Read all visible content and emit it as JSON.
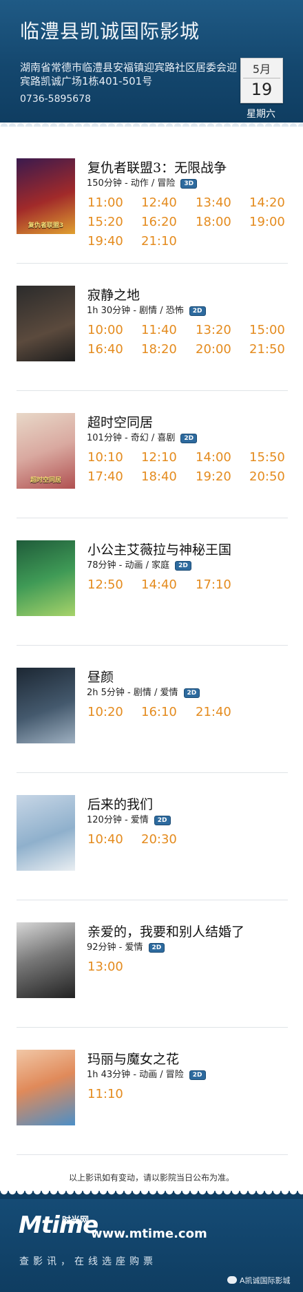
{
  "header": {
    "title": "临澧县凯诚国际影城",
    "address": "湖南省常德市临澧县安福镇迎宾路社区居委会迎宾路凯诚广场1栋401-501号",
    "phone": "0736-5895678",
    "month": "5月",
    "day": "19",
    "weekday": "星期六"
  },
  "movies": [
    {
      "name": "复仇者联盟3：无限战争",
      "info": "150分钟 - 动作 / 冒险",
      "format": "3D",
      "poster_caption": "复仇者联盟3",
      "times": [
        "11:00",
        "12:40",
        "13:40",
        "14:20",
        "15:20",
        "16:20",
        "18:00",
        "19:00",
        "19:40",
        "21:10"
      ]
    },
    {
      "name": "寂静之地",
      "info": "1h 30分钟 - 剧情 / 恐怖",
      "format": "2D",
      "poster_caption": "",
      "times": [
        "10:00",
        "11:40",
        "13:20",
        "15:00",
        "16:40",
        "18:20",
        "20:00",
        "21:50"
      ]
    },
    {
      "name": "超时空同居",
      "info": "101分钟 - 奇幻 / 喜剧",
      "format": "2D",
      "poster_caption": "超时空同居",
      "times": [
        "10:10",
        "12:10",
        "14:00",
        "15:50",
        "17:40",
        "18:40",
        "19:20",
        "20:50"
      ]
    },
    {
      "name": "小公主艾薇拉与神秘王国",
      "info": "78分钟 - 动画 / 家庭",
      "format": "2D",
      "poster_caption": "",
      "times": [
        "12:50",
        "14:40",
        "17:10"
      ]
    },
    {
      "name": "昼颜",
      "info": "2h 5分钟 - 剧情 / 爱情",
      "format": "2D",
      "poster_caption": "",
      "times": [
        "10:20",
        "16:10",
        "21:40"
      ]
    },
    {
      "name": "后来的我们",
      "info": "120分钟 - 爱情",
      "format": "2D",
      "poster_caption": "",
      "times": [
        "10:40",
        "20:30"
      ]
    },
    {
      "name": "亲爱的，我要和别人结婚了",
      "info": "92分钟 - 爱情",
      "format": "2D",
      "poster_caption": "",
      "times": [
        "13:00"
      ]
    },
    {
      "name": "玛丽与魔女之花",
      "info": "1h 43分钟 - 动画 / 冒险",
      "format": "2D",
      "poster_caption": "",
      "times": [
        "11:10"
      ]
    }
  ],
  "notice": "以上影讯如有变动，请以影院当日公布为准。",
  "footer": {
    "logo_letter": "Mtime",
    "logo_cn": "时光网",
    "site": "www.mtime.com",
    "slogan": "查影讯，在线选座购票",
    "wechat": "A凯诚国际影城"
  },
  "colors": {
    "header": "#14476e",
    "time": "#e48b1e",
    "badge": "#2d6a9e"
  }
}
